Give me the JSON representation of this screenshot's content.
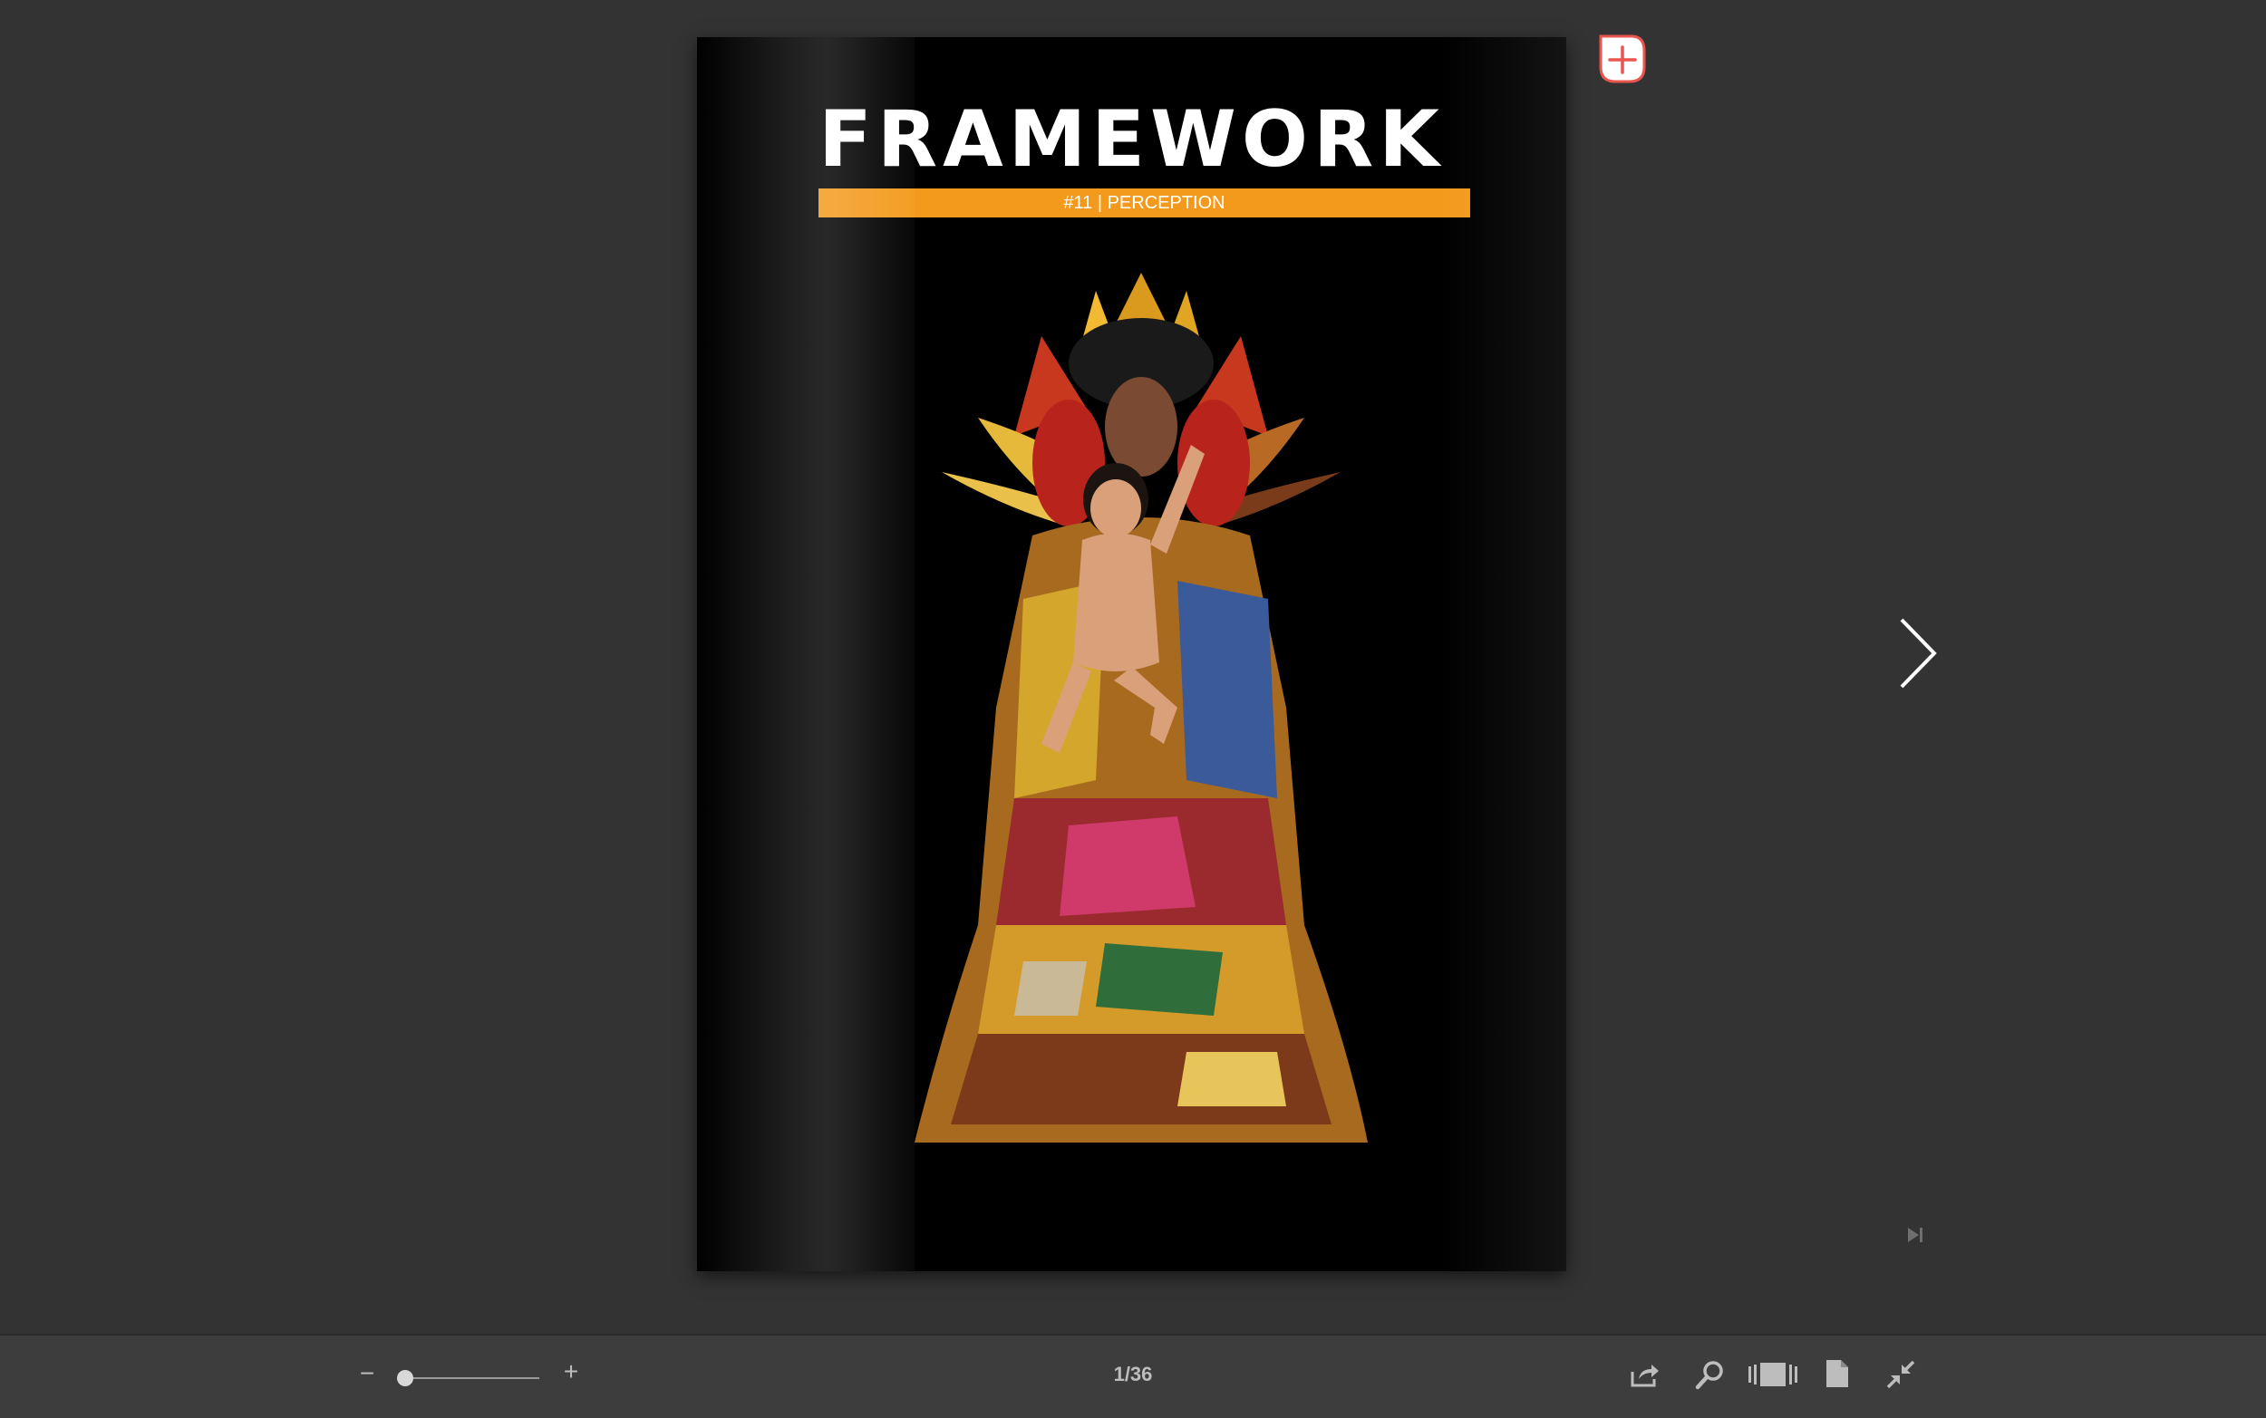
{
  "cover": {
    "masthead": "FRAMEWORK",
    "issue_label": "#11 | PERCEPTION"
  },
  "viewer": {
    "page_counter": "1/36",
    "zoom_minus_label": "−",
    "zoom_plus_label": "+",
    "zoom_level": 0.0
  },
  "colors": {
    "background": "#333333",
    "toolbar": "#3d3d3d",
    "issue_bar": "#f39a1d",
    "add_button_accent": "#e8554e"
  },
  "icons": {
    "add": "add-page-icon",
    "next": "chevron-right-icon",
    "last": "skip-to-end-icon",
    "share": "share-icon",
    "search": "search-icon",
    "thumbnails": "thumbnails-icon",
    "single_page": "single-page-icon",
    "fullscreen_exit": "exit-fullscreen-icon"
  }
}
